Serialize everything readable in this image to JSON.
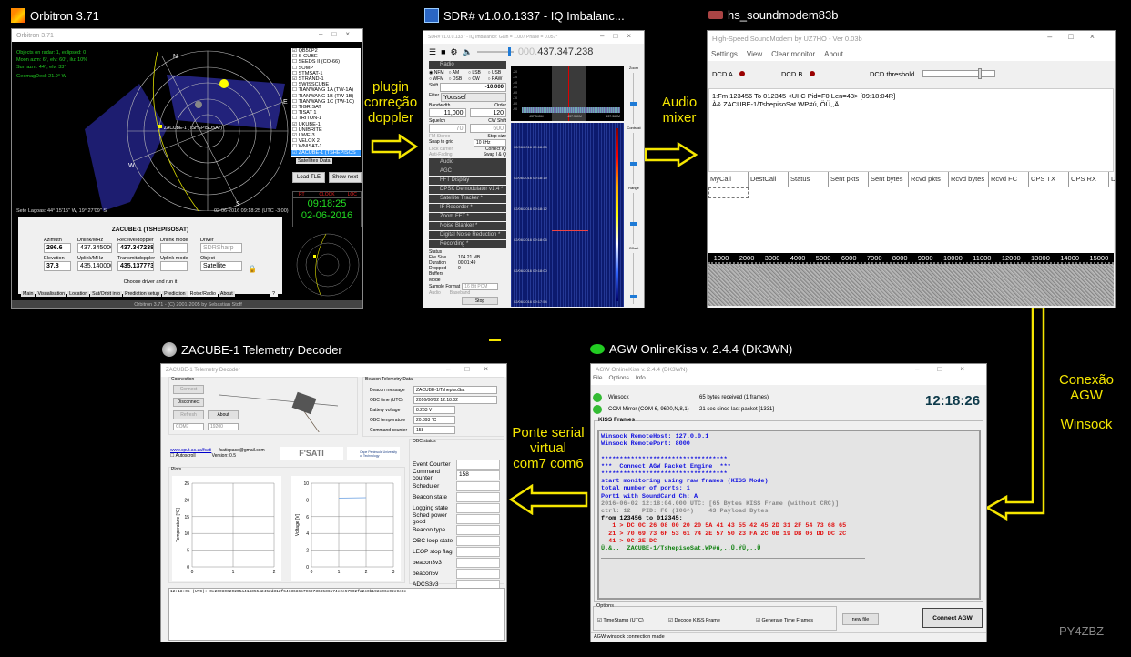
{
  "orbitron": {
    "app_label": "Orbitron 3.71",
    "window_title": "Orbitron 3.71",
    "info": [
      "Objects on radar: 1, eclipsed: 0",
      "Moon azm: 6°, elv: 60°, ilu: 10%",
      "Sun azm: 44°, elv: 33°",
      "GeomagDecl: 21.9° W"
    ],
    "compass": {
      "n": "N",
      "e": "E",
      "s": "S",
      "w": "W"
    },
    "sat_marker": "ZACUBE-1 (TSHEPISOSAT)",
    "location": "Sete Lagoas: 44° 15'15'' W, 19° 27'09'' S",
    "datetime": "02-06-2016 09:18:25 (UTC -3:00)",
    "satellites": [
      {
        "name": "QB50P2",
        "checked": true
      },
      {
        "name": "S-CUBE",
        "checked": false
      },
      {
        "name": "SEEDS II (CO-66)",
        "checked": false
      },
      {
        "name": "SOMP",
        "checked": false
      },
      {
        "name": "STMSAT-1",
        "checked": false
      },
      {
        "name": "STRAND-1",
        "checked": true
      },
      {
        "name": "SWISSCUBE",
        "checked": false
      },
      {
        "name": "TIANWANG 1A (TW-1A)",
        "checked": false
      },
      {
        "name": "TIANWANG 1B (TW-1B)",
        "checked": false
      },
      {
        "name": "TIANWANG 1C (TW-1C)",
        "checked": false
      },
      {
        "name": "TIGRISAT",
        "checked": false
      },
      {
        "name": "TISAT 1",
        "checked": false
      },
      {
        "name": "TRITON-1",
        "checked": false
      },
      {
        "name": "UKUBE-1",
        "checked": true
      },
      {
        "name": "UNIBRITE",
        "checked": false
      },
      {
        "name": "UWE-3",
        "checked": true
      },
      {
        "name": "VELOX 2",
        "checked": false
      },
      {
        "name": "WNISAT-1",
        "checked": false
      },
      {
        "name": "ZACUBE-1 (TSHEPISOS",
        "checked": true
      }
    ],
    "list_tabs": [
      "Satellites",
      "Data"
    ],
    "load_tle": "Load TLE",
    "show_next": "Show next",
    "clock_tabs": [
      "RT",
      "CLOCK",
      "LOC"
    ],
    "clock_time": "09:18:25",
    "clock_date": "02-06-2016",
    "panel_title": "ZACUBE-1 (TSHEPISOSAT)",
    "azimuth_label": "Azimuth",
    "azimuth": "296.6",
    "elevation_label": "Elevation",
    "elevation": "37.8",
    "downlink_label": "Dnlink/MHz",
    "downlink": "437.345000",
    "uplink_label": "Uplink/MHz",
    "uplink": "435.140000",
    "rx_label": "Receive/doppler",
    "rx": "437.347238",
    "tx_label": "Transmit/doppler",
    "tx": "435.137773",
    "dnmode_label": "Dnlink mode",
    "upmode_label": "Uplink mode",
    "driver_label": "Driver",
    "driver": "SDRSharp",
    "object_label": "Object",
    "object": "Satellite",
    "hint": "Choose driver and run it",
    "tabs": [
      "Main",
      "Visualisation",
      "Location",
      "Sat/Orbit info",
      "Prediction setup",
      "Prediction",
      "Rotor/Radio",
      "About"
    ],
    "help": "?",
    "footer": "Orbitron 3.71 - (C) 2001-2005 by Sebastian Stoff"
  },
  "arrow_labels": {
    "doppler": "plugin\ncorreção\ndoppler",
    "audio": "Audio\nmixer",
    "agw": "Conexão\nAGW",
    "winsock": "Winsock",
    "serial": "Ponte serial\nvirtual\ncom7 com6"
  },
  "sdr": {
    "app_label": "SDR# v1.0.0.1337 - IQ Imbalanc...",
    "window_title": "SDR# v1.0.0.1337 - IQ Imbalance: Gain = 1.007 Phase = 0.057°",
    "freq_prefix": "000.",
    "frequency": "437.347.238",
    "radio_header": "Radio",
    "modes": [
      "NFM",
      "AM",
      "LSB",
      "USB",
      "WFM",
      "DSB",
      "CW",
      "RAW"
    ],
    "shift_label": "Shift",
    "shift": "-10.000",
    "filter_label": "Filter",
    "filter": "Youssef",
    "bandwidth_label": "Bandwidth",
    "bandwidth": "11,000",
    "order_label": "Order",
    "order": "120",
    "squelch_label": "Squelch",
    "cw_shift_label": "CW Shift",
    "squelch": "70",
    "cw_shift": "600",
    "fm_stereo": "FM Stereo",
    "step_size": "Step size",
    "snap": "Snap to grid",
    "step": "10 kHz",
    "lock_carrier": "Lock carrier",
    "correct_iq": "Correct IQ",
    "anti_fading": "Anti-Fading",
    "swap_iq": "Swap I & Q",
    "plugins": [
      "Audio",
      "AGC",
      "FFT Display",
      "DPSK Demodulator v1.4 *",
      "Satellite Tracker *",
      "IF Recorder *",
      "Zoom FFT *",
      "Noise Blanker *",
      "Digital Noise Reduction *",
      "Recording *"
    ],
    "status_label": "Status",
    "file_size_label": "File Size",
    "file_size": "104.21 MB",
    "duration_label": "Duration",
    "duration": "00:01:49",
    "dropped_label": "Dropped Buffers",
    "dropped": "0",
    "mode_label": "Mode",
    "sample_format_label": "Sample Format",
    "sample_format": "16 Bit PCM",
    "audio_label": "Audio",
    "baseband_label": "Baseband",
    "stop": "Stop",
    "spectrum_db": [
      "-20",
      "-30",
      "-40",
      "-50",
      "-60",
      "-70",
      "-80",
      "-90"
    ],
    "spectrum_freqs": [
      "437.340M",
      "437.350M",
      "437.360M"
    ],
    "waterfall_times": [
      "02/06/2016 09:18:25",
      "02/06/2016 09:18:19",
      "02/06/2016 09:18:12",
      "02/06/2016 09:18:06",
      "02/06/2016 09:18:00",
      "02/06/2016 09:17:54"
    ],
    "sliders": [
      "Zoom",
      "Contrast",
      "Range",
      "Offset"
    ]
  },
  "soundmodem": {
    "app_label": "hs_soundmodem83b",
    "window_title": "High-Speed SoundModem by UZ7HO - Ver 0.03b",
    "menu": [
      "Settings",
      "View",
      "Clear monitor",
      "About"
    ],
    "dcd_a": "DCD A",
    "dcd_b": "DCD B",
    "dcd_threshold": "DCD threshold",
    "monitor": [
      "1:Fm 123456 To 012345 <UI C Pid=F0 Len=43> [09:18:04R]",
      "À&  ZACUBE-1/TshepisoSat.WP#ú,.ÖÜ,,Ä"
    ],
    "columns": [
      "MyCall",
      "DestCall",
      "Status",
      "Sent pkts",
      "Sent bytes",
      "Rcvd pkts",
      "Rcvd bytes",
      "Rcvd FC",
      "CPS TX",
      "CPS RX",
      "D"
    ],
    "scale": [
      "1000",
      "2000",
      "3000",
      "4000",
      "5000",
      "6000",
      "7000",
      "8000",
      "9000",
      "10000",
      "11000",
      "12000",
      "13000",
      "14000",
      "15000"
    ]
  },
  "agw": {
    "app_label": "AGW OnlineKiss v. 2.4.4  (DK3WN)",
    "window_title": "AGW OnlineKiss v. 2.4.4  (DK3WN)",
    "menu": [
      "File",
      "Options",
      "Info"
    ],
    "winsock": "Winsock",
    "winsock_status": "65 bytes received (1 frames)",
    "com": "COM Mirror (COM 6, 9600,N,8,1)",
    "com_status": "21 sec since last packet [1331]",
    "clock": "12:18:26",
    "frames_label": "KISS Frames",
    "lines": [
      {
        "t": "Winsock RemoteHost: 127.0.0.1",
        "c": "blue"
      },
      {
        "t": "Winsock RemotePort: 8000",
        "c": "blue"
      },
      {
        "t": " ",
        "c": "blue"
      },
      {
        "t": "**********************************",
        "c": "blue"
      },
      {
        "t": "***  Connect AGW Packet Engine  ***",
        "c": "blue"
      },
      {
        "t": "**********************************",
        "c": "blue"
      },
      {
        "t": "start monitoring using raw frames (KISS Mode)",
        "c": "blue"
      },
      {
        "t": "total number of ports: 1",
        "c": "blue"
      },
      {
        "t": "Port1 with SoundCard Ch: A",
        "c": "blue"
      },
      {
        "t": "2016-06-02 12:18:04.000 UTC: [65 Bytes KISS Frame (without CRC)]",
        "c": "gray"
      },
      {
        "t": "ctrl: 12   PID: F0 (I06^)    43 Payload Bytes",
        "c": "gray"
      },
      {
        "t": "from 123456 to 012345:",
        "c": "black"
      },
      {
        "t": "   1 > DC 0C 26 08 00 20 20 5A 41 43 55 42 45 2D 31 2F 54 73 68 65",
        "c": "red"
      },
      {
        "t": "  21 > 70 69 73 6F 53 61 74 2E 57 50 23 FA 2C 0B 19 DB 06 DD DC 2C",
        "c": "red"
      },
      {
        "t": "  41 > 0C 2E DC",
        "c": "red"
      },
      {
        "t": "Ü.&..  ZACUBE-1/TshepisoSat.WP#ú,..Û.ÝÜ,..Ü",
        "c": "green"
      }
    ],
    "options_label": "Options",
    "opt_timestamp": "TimeStamp (UTC)",
    "opt_decode": "Decode KISS Frame",
    "opt_generate": "Generate Time Frames",
    "new_file": "new file",
    "connect": "Connect AGW",
    "status": "AGW winsock connection made"
  },
  "telemetry": {
    "app_label": "ZACUBE-1 Telemetry Decoder",
    "window_title": "ZACUBE-1 Telemetry Decoder",
    "connection_label": "Connection",
    "connect": "Connect",
    "disconnect": "Disconnect",
    "refresh": "Refresh",
    "about": "About",
    "port": "COM7",
    "baud": "19200",
    "beacon_label": "Beacon Telemetry Data",
    "fields": [
      {
        "label": "Beacon message",
        "value": "ZACUBE-1/TshepisoSat"
      },
      {
        "label": "OBC time (UTC)",
        "value": "2016/06/02 12:18:02"
      },
      {
        "label": "Battery voltage",
        "value": "8.263 V"
      },
      {
        "label": "OBC temperature",
        "value": "20.893 °C"
      },
      {
        "label": "Command counter",
        "value": "158"
      }
    ],
    "link": "www.cput.ac.za/fsati",
    "email": "fsatispace@gmail.com",
    "autoscroll": "Autoscroll",
    "version": "Version: 0.5",
    "logo1": "F'SATI",
    "logo2": "Cape Peninsula University of Technology",
    "plots_label": "Plots",
    "obc_label": "OBC status",
    "obc": [
      {
        "label": "Event Counter",
        "value": ""
      },
      {
        "label": "Command counter",
        "value": "158"
      },
      {
        "label": "Scheduler",
        "value": ""
      },
      {
        "label": "Beacon state",
        "value": ""
      },
      {
        "label": "Logging state",
        "value": ""
      },
      {
        "label": "Sched power good",
        "value": ""
      },
      {
        "label": "Beacon type",
        "value": ""
      },
      {
        "label": "OBC loop state",
        "value": ""
      },
      {
        "label": "LEOP stop flag",
        "value": ""
      },
      {
        "label": "beacon3v3",
        "value": ""
      },
      {
        "label": "beacon5v",
        "value": ""
      },
      {
        "label": "ADCS3v3",
        "value": ""
      },
      {
        "label": "ADCS5v",
        "value": ""
      },
      {
        "label": "i2c - SDA",
        "value": ""
      },
      {
        "label": "i2c - SCL",
        "value": ""
      }
    ],
    "log": "12:18:05 (UTC): 0x26080020205a41435542452d312f5473686579697368536174e2e57502fa2c0b192c06c02c9e2e"
  },
  "chart_data": [
    {
      "type": "line",
      "ylabel": "Temperature [°C]",
      "xlabel": "",
      "x_ticks": [
        "0",
        "1",
        "2"
      ],
      "y_ticks": [
        "0",
        "5",
        "10",
        "15",
        "20",
        "25"
      ],
      "xlim": [
        0,
        2
      ],
      "ylim": [
        0,
        25
      ],
      "series": []
    },
    {
      "type": "line",
      "ylabel": "Voltage [V]",
      "xlabel": "",
      "x_ticks": [
        "0",
        "1",
        "2",
        "3"
      ],
      "y_ticks": [
        "0",
        "2",
        "4",
        "6",
        "8",
        "10"
      ],
      "xlim": [
        0,
        3
      ],
      "ylim": [
        0,
        10
      ],
      "series": [
        {
          "name": "Battery voltage",
          "x": [
            1,
            2
          ],
          "y": [
            8.2,
            8.26
          ]
        }
      ]
    }
  ],
  "watermark": "PY4ZBZ",
  "colors": {
    "arrow": "#f5e600",
    "agw_blue": "#1010e0",
    "agw_red": "#e01010",
    "agw_green": "#108010",
    "clock_green": "#22dd22"
  }
}
